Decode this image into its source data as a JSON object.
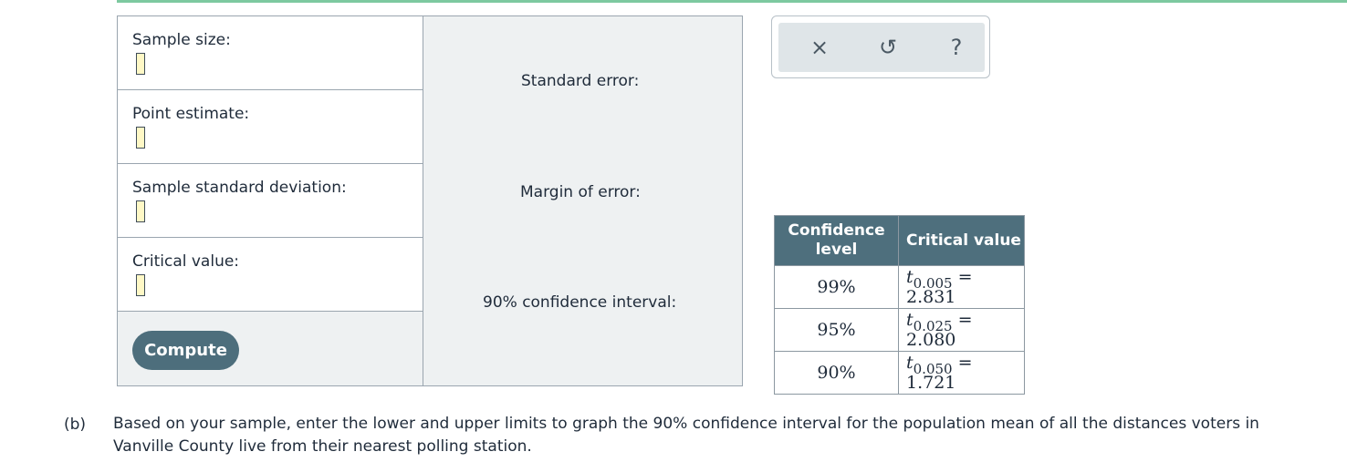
{
  "panel": {
    "sample_size_label": "Sample size:",
    "point_estimate_label": "Point estimate:",
    "sample_sd_label": "Sample standard deviation:",
    "critical_value_label": "Critical value:",
    "compute_label": "Compute",
    "standard_error_label": "Standard error:",
    "margin_error_label": "Margin of error:",
    "ci_label": "90% confidence interval:"
  },
  "toolbar": {
    "close_glyph": "×",
    "undo_glyph": "↺",
    "help_glyph": "?"
  },
  "table": {
    "headers": {
      "col1": "Confidence level",
      "col2": "Critical value"
    },
    "rows": [
      {
        "level": "99%",
        "t": "t",
        "sub": "0.005",
        "eq": "= 2.831"
      },
      {
        "level": "95%",
        "t": "t",
        "sub": "0.025",
        "eq": "= 2.080"
      },
      {
        "level": "90%",
        "t": "t",
        "sub": "0.050",
        "eq": "= 1.721"
      }
    ]
  },
  "part_b": {
    "tag": "(b)",
    "text": "Based on your sample, enter the lower and upper limits to graph the 90% confidence interval for the population mean of all the distances voters in Vanville County live from their nearest polling station."
  },
  "colors": {
    "accent_bar": "#7dc9a0",
    "button": "#4d6e7c",
    "table_header": "#4e6f7d",
    "input_fill": "#fff8c6"
  }
}
